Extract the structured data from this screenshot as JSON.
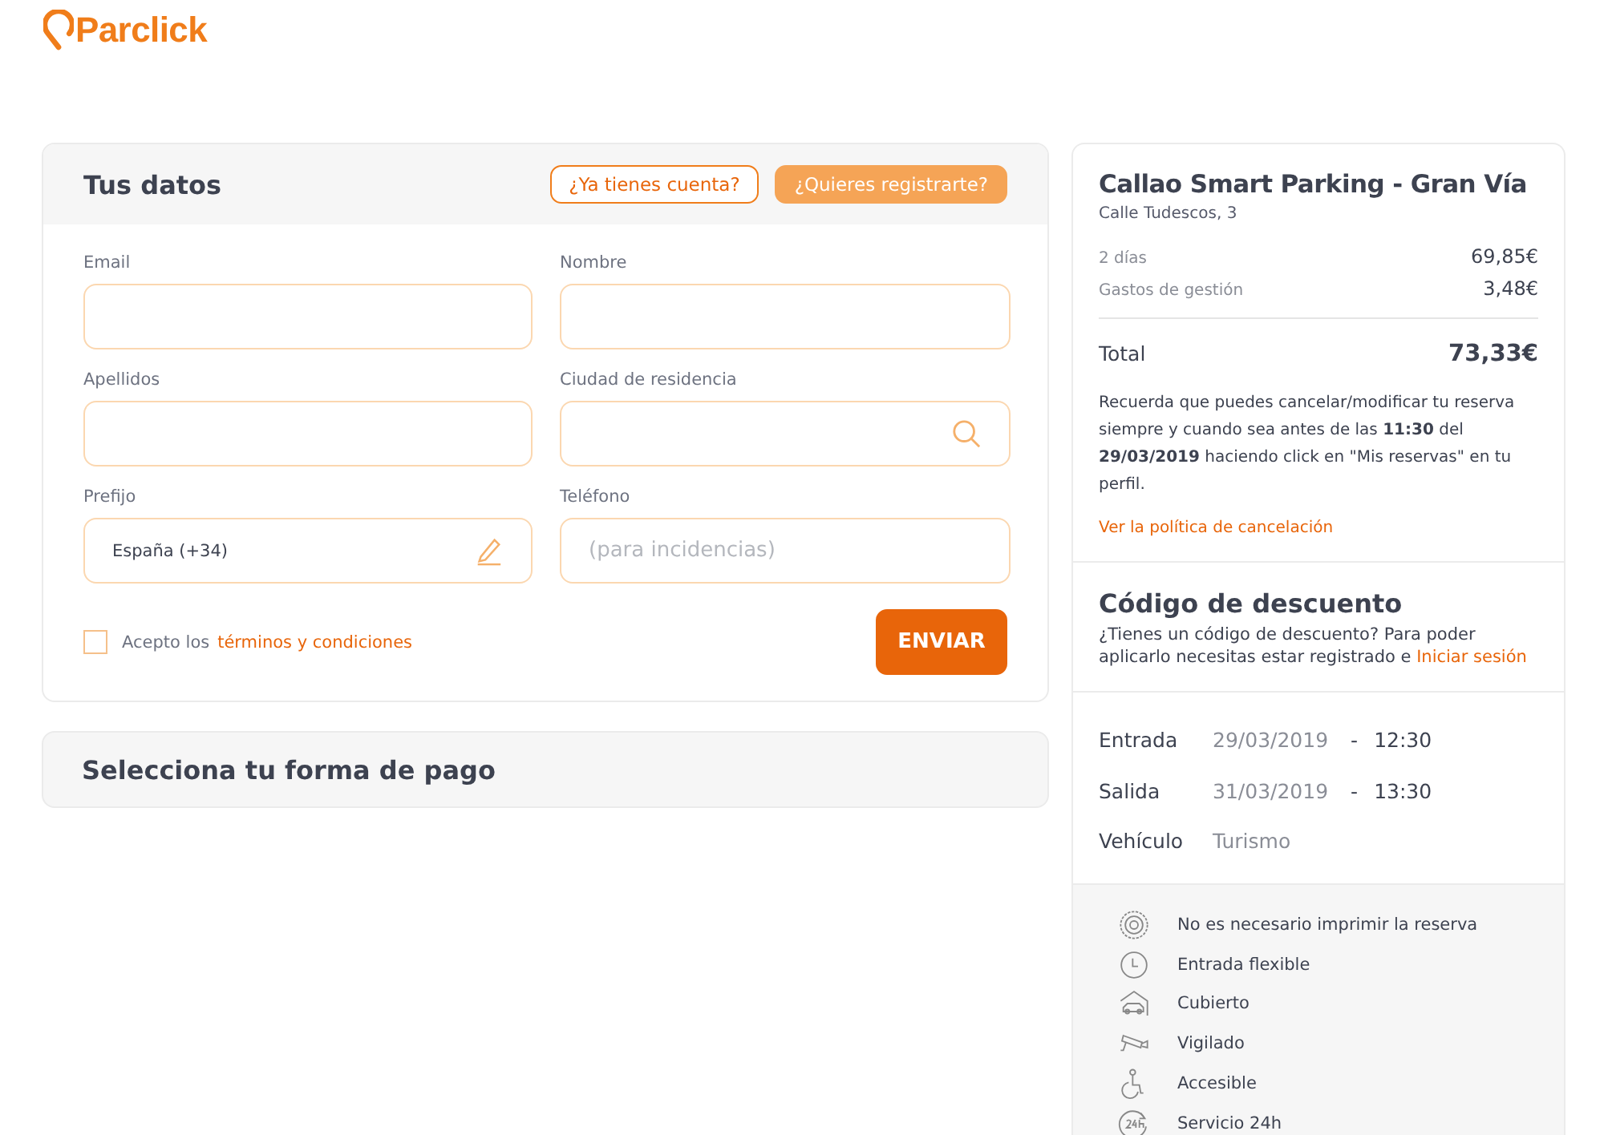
{
  "logo": {
    "text": "Parclick"
  },
  "form": {
    "title": "Tus datos",
    "header_buttons": [
      {
        "label": "¿Ya tienes cuenta?",
        "kind": "outline"
      },
      {
        "label": "¿Quieres registrarte?",
        "kind": "filled"
      }
    ],
    "fields": [
      {
        "label": "Email",
        "kind": "text"
      },
      {
        "label": "Nombre",
        "kind": "text"
      },
      {
        "label": "Apellidos",
        "kind": "text"
      },
      {
        "label": "Ciudad de residencia",
        "kind": "search"
      },
      {
        "label": "Prefijo",
        "kind": "select",
        "value": "España (+34)"
      },
      {
        "label": "Teléfono",
        "kind": "text",
        "placeholder": "(para incidencias)"
      }
    ],
    "terms": {
      "checked": false,
      "text": "Acepto los",
      "link": "términos y condiciones"
    },
    "submit": "ENVIAR"
  },
  "payment": {
    "title": "Selecciona tu forma de pago"
  },
  "summary": {
    "title": "Callao Smart Parking - Gran Vía",
    "address": "Calle Tudescos, 3",
    "lines": [
      {
        "label": "2 días",
        "amount": "69,85€"
      },
      {
        "label": "Gastos de gestión",
        "amount": "3,48€"
      }
    ],
    "total_label": "Total",
    "total": "73,33€",
    "notice": "Recuerda que puedes cancelar/modificar tu reserva siempre y cuando sea antes de las **11:30** del **29/03/2019** haciendo click en \"Mis reservas\" en tu perfil.",
    "policy_link": "Ver la política de cancelación"
  },
  "discount": {
    "title": "Código de descuento",
    "text": "¿Tienes un código de descuento? Para poder aplicarlo necesitas estar registrado e",
    "link": "Iniciar sesión"
  },
  "booking": [
    {
      "label": "Entrada",
      "date": "29/03/2019",
      "sep": "-",
      "time": "12:30"
    },
    {
      "label": "Salida",
      "date": "31/03/2019",
      "sep": "-",
      "time": "13:30"
    },
    {
      "label": "Vehículo",
      "date": "Turismo"
    }
  ],
  "features": [
    {
      "kind": "badge",
      "label": "No es necesario imprimir la reserva"
    },
    {
      "kind": "clock",
      "label": "Entrada flexible"
    },
    {
      "kind": "garage",
      "label": "Cubierto"
    },
    {
      "kind": "camera",
      "label": "Vigilado"
    },
    {
      "kind": "accessible",
      "label": "Accesible"
    },
    {
      "kind": "hours",
      "label": "Servicio 24h"
    }
  ]
}
